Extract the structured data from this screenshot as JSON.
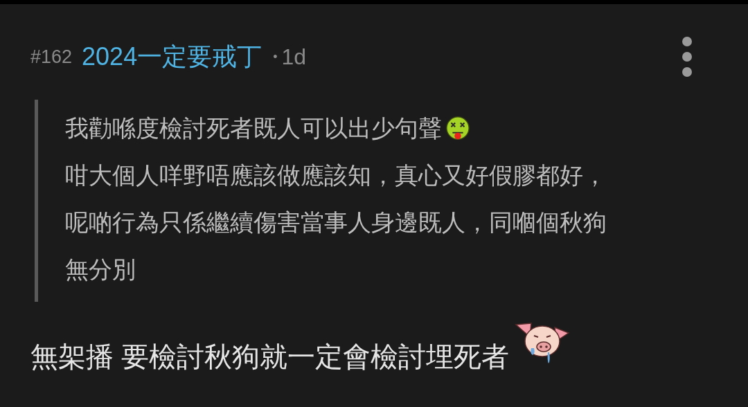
{
  "post": {
    "number": "#162",
    "username": "2024一定要戒丁",
    "separator": "•",
    "time": "1d"
  },
  "quote": {
    "lines": [
      "我勸喺度檢討死者既人可以出少句聲",
      "咁大個人咩野唔應該做應該知，真心又好假膠都好，",
      "呢啲行為只係繼續傷害當事人身邊既人，同嗰個秋狗",
      "無分別"
    ]
  },
  "reply": {
    "text": "無架播 要檢討秋狗就一定會檢討埋死者"
  }
}
